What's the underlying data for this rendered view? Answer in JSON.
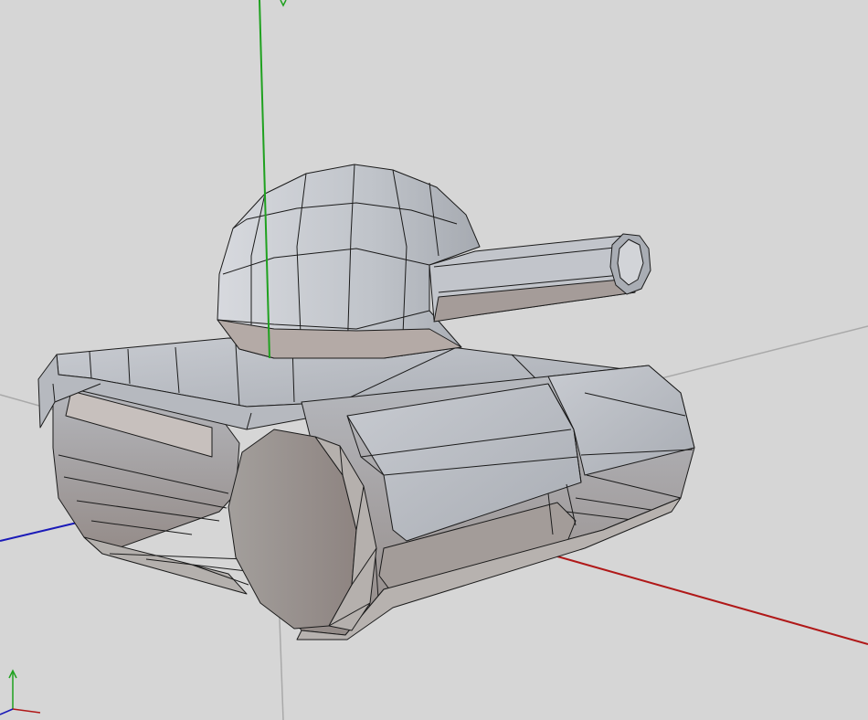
{
  "viewport": {
    "background_color": "#d6d6d6",
    "grid_color": "#a9a9a9",
    "edge_color": "#1b1b1b"
  },
  "axes": {
    "x_color": "#b01818",
    "y_color": "#1fa11f",
    "z_color": "#1a1ab8"
  },
  "model": {
    "name": "tank",
    "parts": [
      "turret-dome",
      "barrel",
      "hull-deck",
      "left-track",
      "right-track",
      "front-wheel"
    ],
    "shade_light": "#c3c6cc",
    "shade_mid": "#aeb2b8",
    "shade_dark": "#9a8e8a"
  },
  "axis_gizmo": {
    "icon": "axis-triad-icon"
  }
}
